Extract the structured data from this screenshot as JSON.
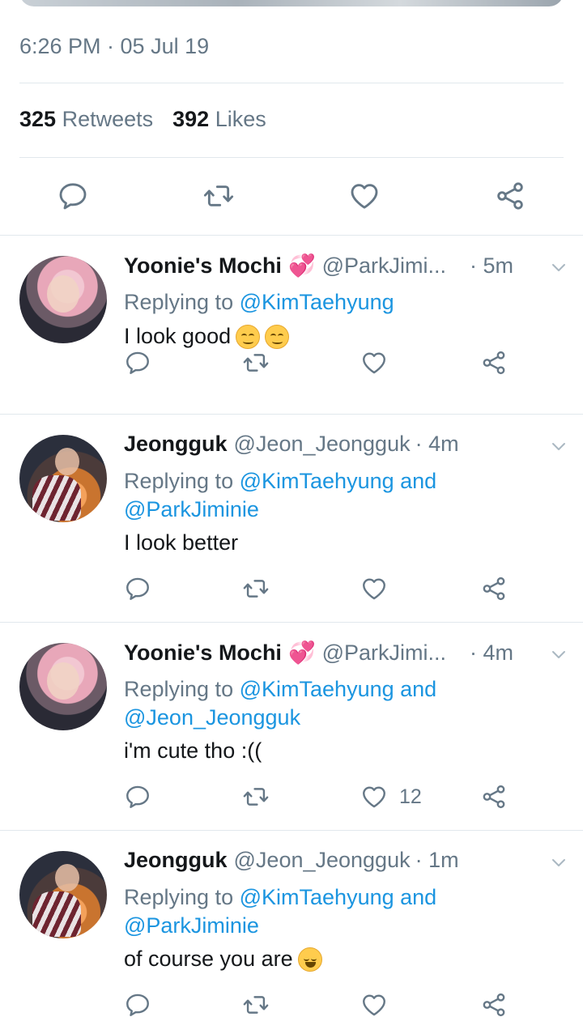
{
  "detail": {
    "timestamp": "6:26 PM · 05 Jul 19",
    "retweets_count": "325",
    "retweets_label": "Retweets",
    "likes_count": "392",
    "likes_label": "Likes"
  },
  "replies": [
    {
      "name": "Yoonie's Mochi",
      "name_emoji": "💞",
      "handle": "@ParkJimi...",
      "time": "· 5m",
      "replying_prefix": "Replying to",
      "replying_line1": "@KimTaehyung",
      "replying_line2": "",
      "text": "I look good",
      "text_emoji": [
        "smiling-face-emoji",
        "smiling-face-emoji"
      ],
      "like_count": ""
    },
    {
      "name": "Jeongguk",
      "handle": "@Jeon_Jeongguk",
      "time": "· 4m",
      "replying_prefix": "Replying to",
      "replying_line1": "@KimTaehyung and",
      "replying_line2": "@ParkJiminie",
      "text": "I look better",
      "like_count": ""
    },
    {
      "name": "Yoonie's Mochi",
      "name_emoji": "💞",
      "handle": "@ParkJimi...",
      "time": "· 4m",
      "replying_prefix": "Replying to",
      "replying_line1": "@KimTaehyung and",
      "replying_line2": "@Jeon_Jeongguk",
      "text": "i'm cute tho :((",
      "like_count": "12"
    },
    {
      "name": "Jeongguk",
      "handle": "@Jeon_Jeongguk",
      "time": "· 1m",
      "replying_prefix": "Replying to",
      "replying_line1": "@KimTaehyung and",
      "replying_line2": "@ParkJiminie",
      "text": "of course you are",
      "text_emoji": [
        "laughing-face-emoji"
      ],
      "like_count": ""
    }
  ],
  "colors": {
    "link": "#1b95e0",
    "secondary_text": "#657786",
    "divider": "#e1e8ed",
    "icon": "#657786"
  },
  "icons": [
    "reply-icon",
    "retweet-icon",
    "like-icon",
    "share-icon",
    "chevron-down-icon"
  ]
}
